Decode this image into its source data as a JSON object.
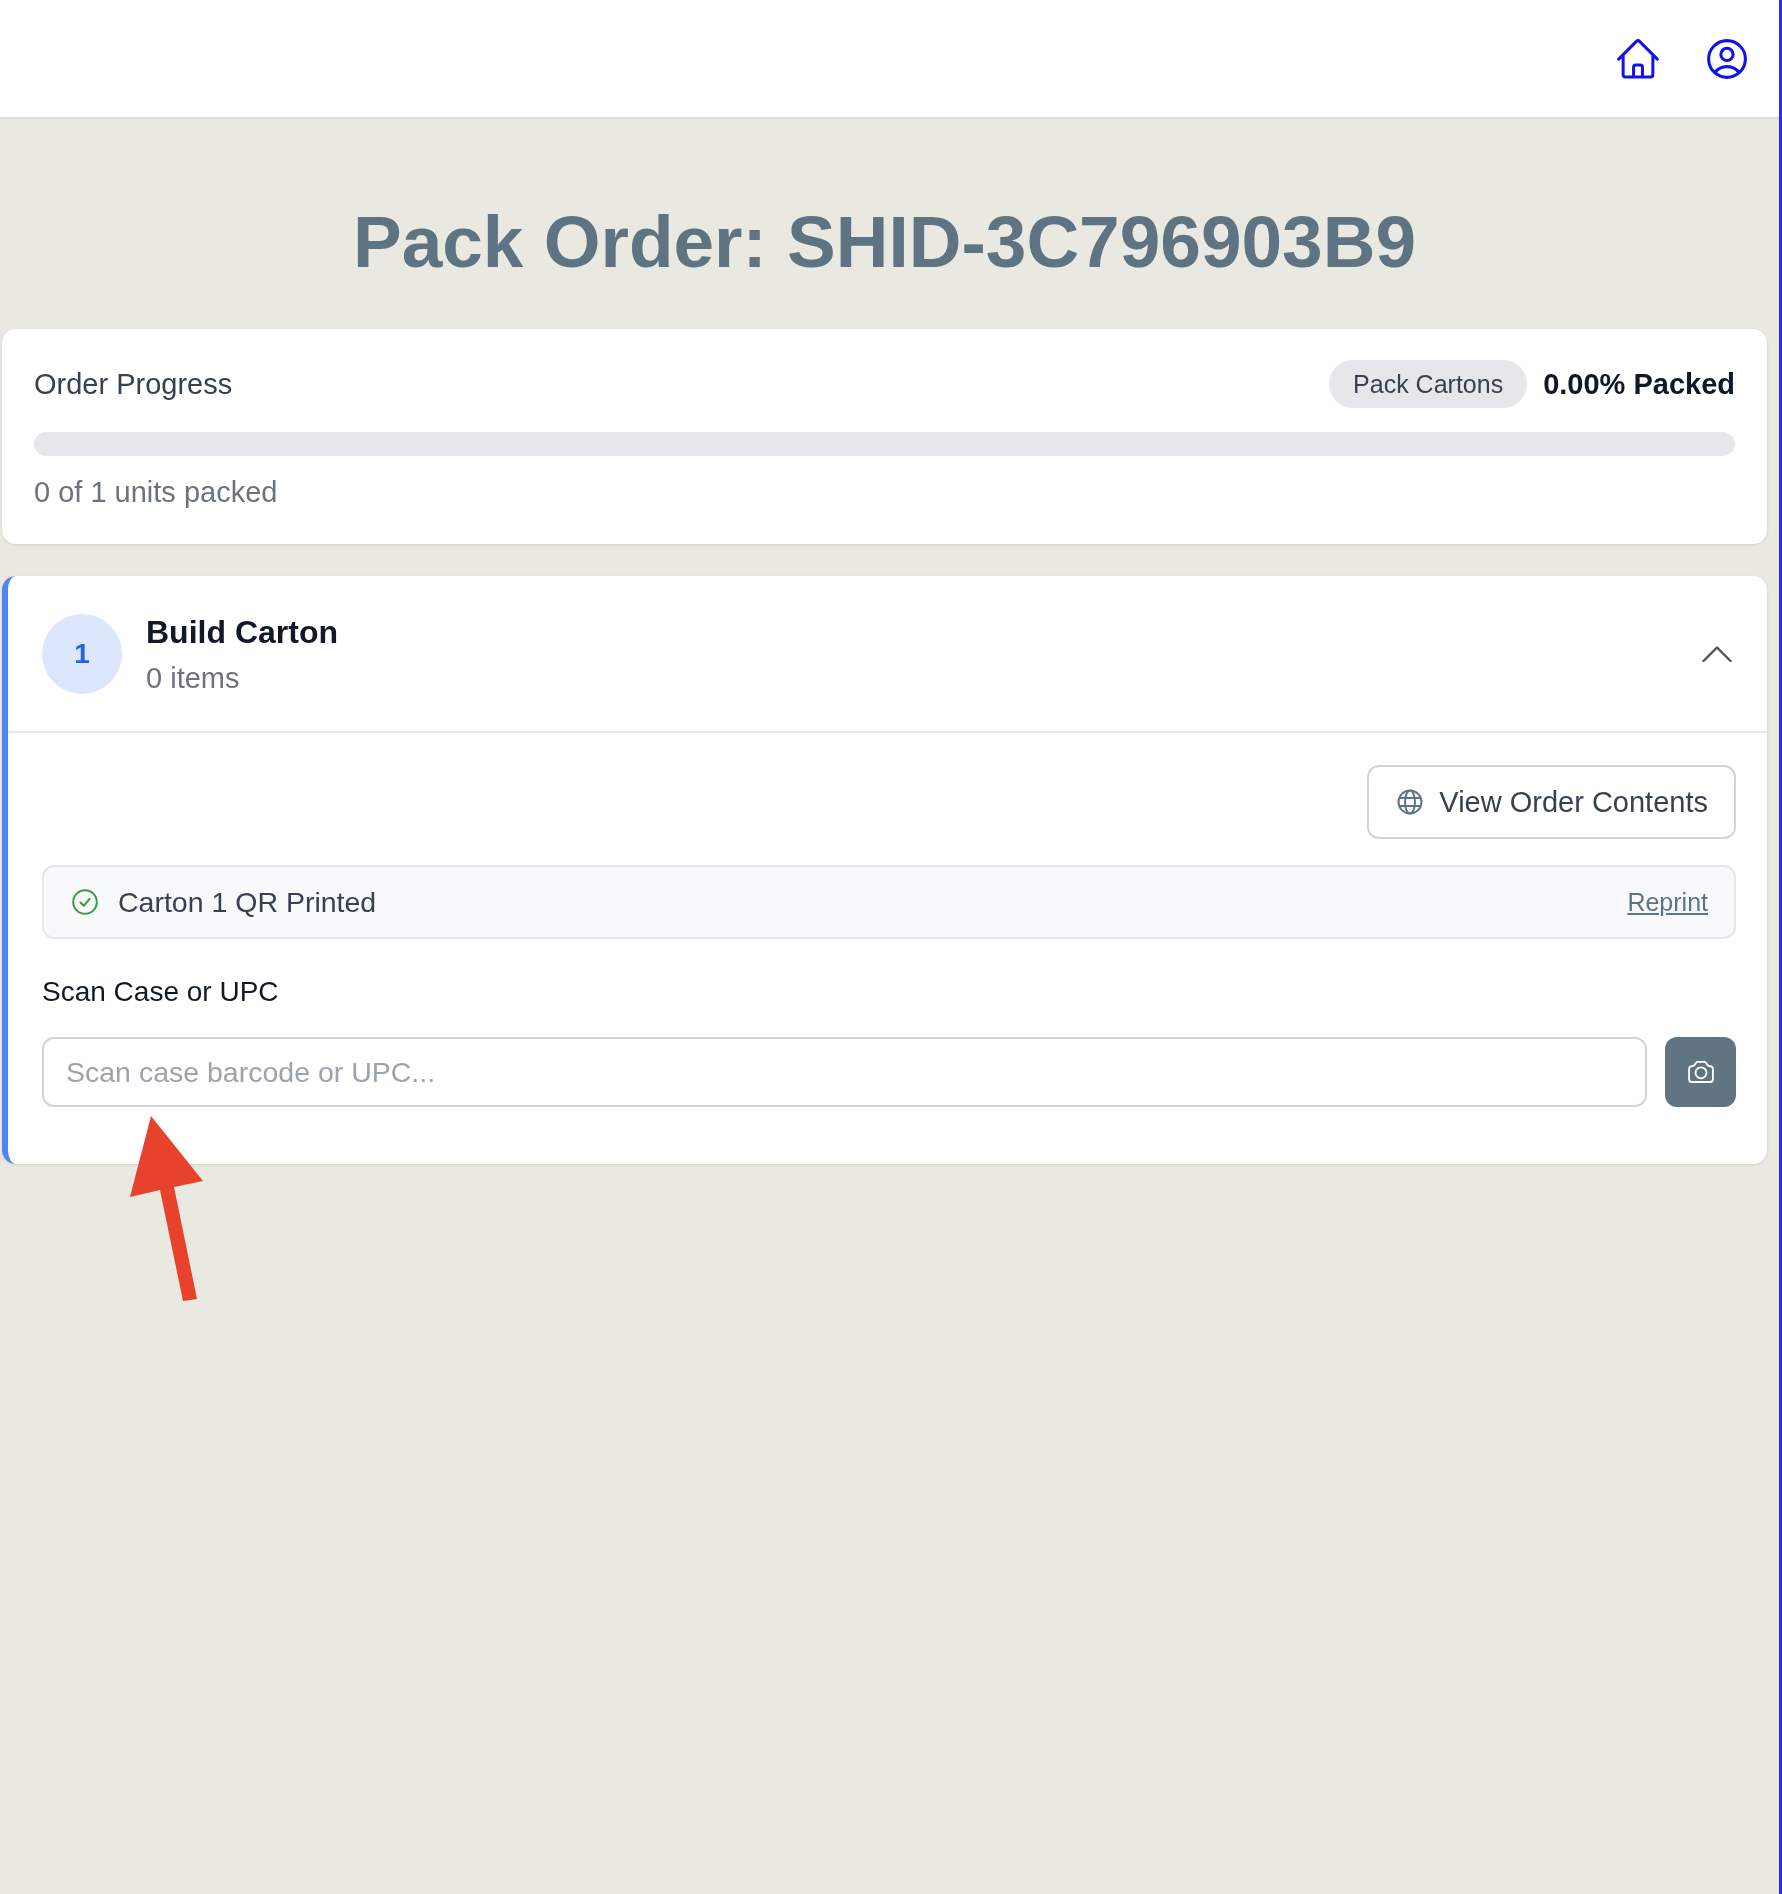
{
  "page_title": "Pack Order: SHID-3C796903B9",
  "order_progress": {
    "title": "Order Progress",
    "stage_badge": "Pack Cartons",
    "percent_label": "0.00% Packed",
    "level": 0,
    "summary": "0 of 1 units packed"
  },
  "cartons": [
    {
      "number": "1",
      "title": "Build Carton",
      "item_count": "0 items",
      "expanded": true,
      "view_contents_button": "View Order Contents",
      "qr_status": {
        "label": "Carton 1 QR Printed",
        "printed": true,
        "action": "Reprint"
      },
      "scan": {
        "label": "Scan Case or UPC",
        "placeholder": "Scan case barcode or UPC..."
      }
    }
  ]
}
